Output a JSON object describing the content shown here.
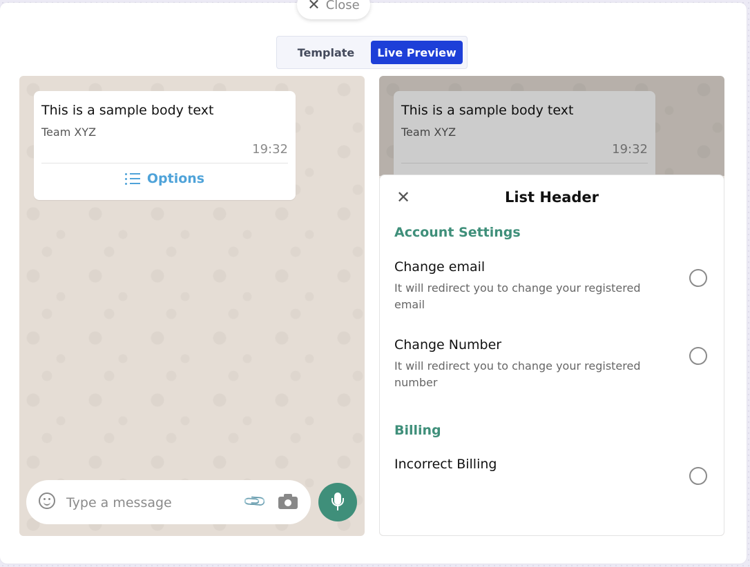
{
  "modal": {
    "close_label": "Close"
  },
  "tabs": [
    {
      "label": "Template",
      "active": false
    },
    {
      "label": "Live Preview",
      "active": true
    }
  ],
  "colors": {
    "accent": "#1d3fd8",
    "whatsapp_green": "#3f8f7a",
    "options_blue": "#4fa3d9"
  },
  "message": {
    "body": "This is a sample body text",
    "footer": "Team XYZ",
    "time": "19:32",
    "button_label": "Options"
  },
  "composer": {
    "placeholder": "Type a message"
  },
  "list": {
    "header": "List Header",
    "sections": [
      {
        "title": "Account Settings",
        "rows": [
          {
            "title": "Change email",
            "description": "It will redirect you to change your registered email"
          },
          {
            "title": "Change Number",
            "description": "It will redirect you to change your registered number"
          }
        ]
      },
      {
        "title": "Billing",
        "rows": [
          {
            "title": "Incorrect Billing",
            "description": ""
          }
        ]
      }
    ]
  }
}
